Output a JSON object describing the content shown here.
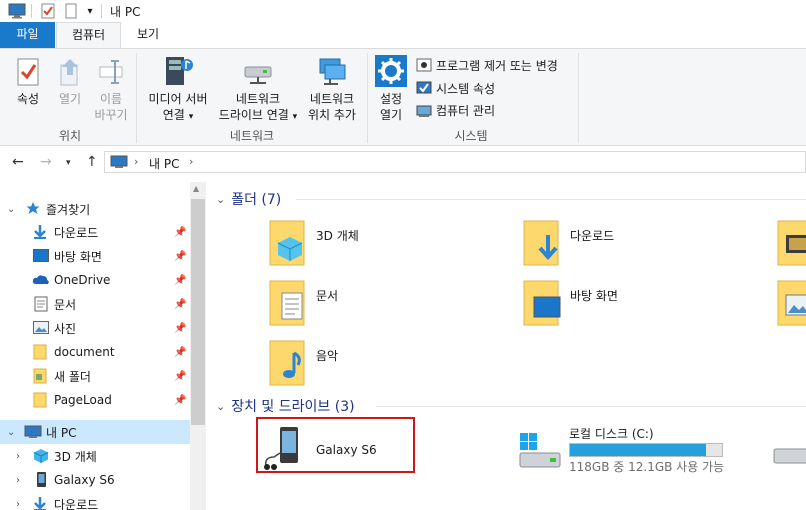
{
  "window": {
    "title": "내 PC"
  },
  "tabs": {
    "file": "파일",
    "computer": "컴퓨터",
    "view": "보기"
  },
  "ribbon": {
    "location": {
      "label": "위치",
      "properties": "속성",
      "open": "열기",
      "rename_line1": "이름",
      "rename_line2": "바꾸기"
    },
    "network": {
      "label": "네트워크",
      "media_line1": "미디어 서버",
      "media_line2": "연결",
      "drive_line1": "네트워크",
      "drive_line2": "드라이브 연결",
      "location_line1": "네트워크",
      "location_line2": "위치 추가"
    },
    "system": {
      "label": "시스템",
      "settings_line1": "설정",
      "settings_line2": "열기",
      "uninstall": "프로그램 제거 또는 변경",
      "sysprops": "시스템 속성",
      "manage": "컴퓨터 관리"
    }
  },
  "address": {
    "path": "내 PC"
  },
  "nav": {
    "quick_access": "즐겨찾기",
    "items": [
      {
        "label": "다운로드"
      },
      {
        "label": "바탕 화면"
      },
      {
        "label": "OneDrive"
      },
      {
        "label": "문서"
      },
      {
        "label": "사진"
      },
      {
        "label": "document"
      },
      {
        "label": "새 폴더"
      },
      {
        "label": "PageLoad"
      }
    ],
    "this_pc": "내 PC",
    "children": [
      {
        "label": "3D 개체"
      },
      {
        "label": "Galaxy S6"
      },
      {
        "label": "다운로드"
      }
    ]
  },
  "content": {
    "folders_header": "폴더 (7)",
    "folders": [
      {
        "name": "3D 개체"
      },
      {
        "name": "다운로드"
      },
      {
        "name": "문서"
      },
      {
        "name": "바탕 화면"
      },
      {
        "name": "음악"
      }
    ],
    "devices_header": "장치 및 드라이브 (3)",
    "devices": {
      "phone": "Galaxy S6",
      "local_disk": "로컬 디스크 (C:)",
      "local_disk_free": "118GB 중 12.1GB 사용 가능",
      "local_disk_used_fraction": 0.897
    }
  },
  "colors": {
    "accent": "#1979ca",
    "selection": "#cce8ff",
    "highlight_box": "#d0161b",
    "drive_bar": "#26a0da"
  }
}
